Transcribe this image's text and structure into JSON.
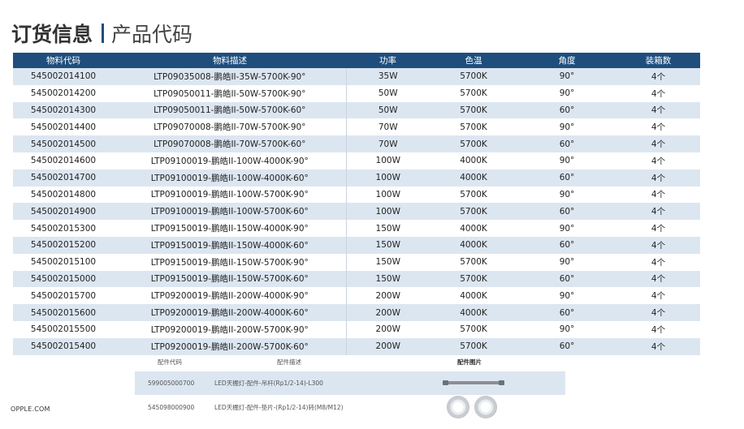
{
  "title": {
    "main": "订货信息",
    "sub": "产品代码"
  },
  "table": {
    "headers": [
      "物料代码",
      "物料描述",
      "功率",
      "色温",
      "角度",
      "装箱数"
    ],
    "rows": [
      [
        "545002014100",
        "LTP09035008-鹏皓II-35W-5700K-90°",
        "35W",
        "5700K",
        "90°",
        "4个"
      ],
      [
        "545002014200",
        "LTP09050011-鹏皓II-50W-5700K-90°",
        "50W",
        "5700K",
        "90°",
        "4个"
      ],
      [
        "545002014300",
        "LTP09050011-鹏皓II-50W-5700K-60°",
        "50W",
        "5700K",
        "60°",
        "4个"
      ],
      [
        "545002014400",
        "LTP09070008-鹏皓II-70W-5700K-90°",
        "70W",
        "5700K",
        "90°",
        "4个"
      ],
      [
        "545002014500",
        "LTP09070008-鹏皓II-70W-5700K-60°",
        "70W",
        "5700K",
        "60°",
        "4个"
      ],
      [
        "545002014600",
        "LTP09100019-鹏皓II-100W-4000K-90°",
        "100W",
        "4000K",
        "90°",
        "4个"
      ],
      [
        "545002014700",
        "LTP09100019-鹏皓II-100W-4000K-60°",
        "100W",
        "4000K",
        "60°",
        "4个"
      ],
      [
        "545002014800",
        "LTP09100019-鹏皓II-100W-5700K-90°",
        "100W",
        "5700K",
        "90°",
        "4个"
      ],
      [
        "545002014900",
        "LTP09100019-鹏皓II-100W-5700K-60°",
        "100W",
        "5700K",
        "60°",
        "4个"
      ],
      [
        "545002015300",
        "LTP09150019-鹏皓II-150W-4000K-90°",
        "150W",
        "4000K",
        "90°",
        "4个"
      ],
      [
        "545002015200",
        "LTP09150019-鹏皓II-150W-4000K-60°",
        "150W",
        "4000K",
        "60°",
        "4个"
      ],
      [
        "545002015100",
        "LTP09150019-鹏皓II-150W-5700K-90°",
        "150W",
        "5700K",
        "90°",
        "4个"
      ],
      [
        "545002015000",
        "LTP09150019-鹏皓II-150W-5700K-60°",
        "150W",
        "5700K",
        "60°",
        "4个"
      ],
      [
        "545002015700",
        "LTP09200019-鹏皓II-200W-4000K-90°",
        "200W",
        "4000K",
        "90°",
        "4个"
      ],
      [
        "545002015600",
        "LTP09200019-鹏皓II-200W-4000K-60°",
        "200W",
        "4000K",
        "60°",
        "4个"
      ],
      [
        "545002015500",
        "LTP09200019-鹏皓II-200W-5700K-90°",
        "200W",
        "5700K",
        "90°",
        "4个"
      ],
      [
        "545002015400",
        "LTP09200019-鹏皓II-200W-5700K-60°",
        "200W",
        "5700K",
        "60°",
        "4个"
      ]
    ]
  },
  "accessories": {
    "headers": [
      "配件代码",
      "配件描述",
      "配件图片"
    ],
    "rows": [
      {
        "code": "599005000700",
        "desc": "LED天棚灯-配件-吊杆(Rp1/2-14)-L300",
        "image_icon": "hanging-rod-icon"
      },
      {
        "code": "545098000900",
        "desc": "LED天棚灯-配件-垫片-(Rp1/2-14)转(M8/M12)",
        "image_icon": "washer-icon"
      }
    ]
  },
  "footer": {
    "brand": "OPPLE.COM"
  },
  "colors": {
    "header_bg": "#1f4e7d",
    "row_alt_bg": "#dce6f1",
    "title_bar": "#1f4e7d"
  }
}
